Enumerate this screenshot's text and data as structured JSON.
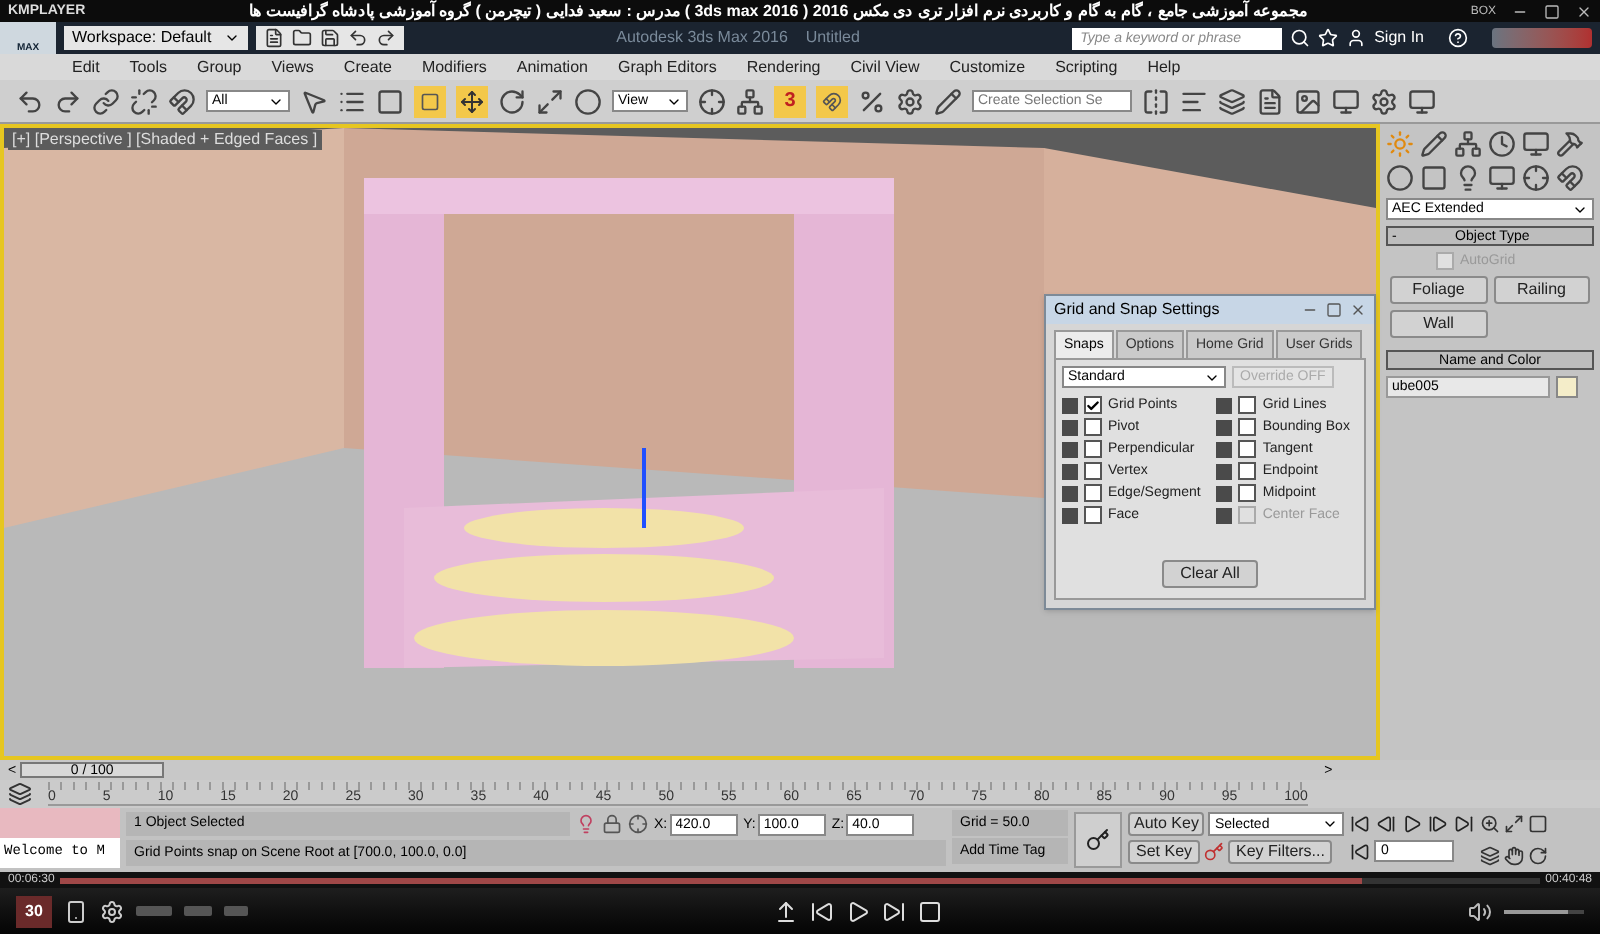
{
  "player": {
    "name": "KMPLAYER",
    "video_title": "مجموعه آموزشی جامع ، گام به گام و کاربردی نرم افزار تری دی مکس 2016 ( 3ds max 2016 )  مدرس : سعید فدایی ( تیچرمن ) گروه آموزشی پادشاه گرافیست ها",
    "box": "BOX"
  },
  "app": {
    "logo_label": "MAX",
    "workspace": "Workspace: Default",
    "title": "Autodesk 3ds Max 2016    Untitled",
    "search": {
      "placeholder": "Type a keyword or phrase"
    },
    "sign_in": "Sign In"
  },
  "menu": [
    "Edit",
    "Tools",
    "Group",
    "Views",
    "Create",
    "Modifiers",
    "Animation",
    "Graph Editors",
    "Rendering",
    "Civil View",
    "Customize",
    "Scripting",
    "Help"
  ],
  "toolbar": {
    "selection_filter": "All",
    "reference_coord": "View",
    "snap_toggle": {
      "label": "3",
      "on": true
    },
    "selection_set": {
      "placeholder": "Create Selection Se"
    }
  },
  "viewport": {
    "label": "[+] [Perspective ] [Shaded + Edged Faces ]",
    "active": true
  },
  "dialog": {
    "title": "Grid and Snap Settings",
    "tabs": [
      {
        "label": "Snaps",
        "selected": true
      },
      {
        "label": "Options",
        "selected": false
      },
      {
        "label": "Home Grid",
        "selected": false
      },
      {
        "label": "User Grids",
        "selected": false
      }
    ],
    "preset": "Standard",
    "override": {
      "label": "Override OFF",
      "disabled": true
    },
    "snaps": [
      {
        "label": "Grid Points",
        "checked": true,
        "disabled": false
      },
      {
        "label": "Pivot",
        "checked": false,
        "disabled": false
      },
      {
        "label": "Perpendicular",
        "checked": false,
        "disabled": false
      },
      {
        "label": "Vertex",
        "checked": false,
        "disabled": false
      },
      {
        "label": "Edge/Segment",
        "checked": false,
        "disabled": false
      },
      {
        "label": "Face",
        "checked": false,
        "disabled": false
      },
      {
        "label": "Grid Lines",
        "checked": false,
        "disabled": false
      },
      {
        "label": "Bounding Box",
        "checked": false,
        "disabled": false
      },
      {
        "label": "Tangent",
        "checked": false,
        "disabled": false
      },
      {
        "label": "Endpoint",
        "checked": false,
        "disabled": false
      },
      {
        "label": "Midpoint",
        "checked": false,
        "disabled": false
      },
      {
        "label": "Center Face",
        "checked": false,
        "disabled": true
      }
    ],
    "clear": "Clear All"
  },
  "command_panel": {
    "category": "AEC Extended",
    "object_type": {
      "toggle": "-",
      "title": "Object Type",
      "autogrid": {
        "label": "AutoGrid",
        "checked": false,
        "disabled": true
      },
      "buttons": [
        "Foliage",
        "Railing",
        "Wall"
      ]
    },
    "name_and_color": {
      "title": "Name and Color",
      "name": "ube005",
      "color": "#f4edc9"
    }
  },
  "time_slider": {
    "prev": "<",
    "label": "0 / 100",
    "next": ">",
    "level": 0
  },
  "ruler": [
    "0",
    "5",
    "10",
    "15",
    "20",
    "25",
    "30",
    "35",
    "40",
    "45",
    "50",
    "55",
    "60",
    "65",
    "70",
    "75",
    "80",
    "85",
    "90",
    "95",
    "100"
  ],
  "status": {
    "listener": "Welcome to M",
    "selection": "1 Object Selected",
    "prompt": "Grid Points snap on Scene Root at [700.0, 100.0, 0.0]",
    "coords": [
      {
        "label": "X:",
        "value": "420.0"
      },
      {
        "label": "Y:",
        "value": "100.0"
      },
      {
        "label": "Z:",
        "value": "40.0"
      }
    ],
    "grid": "Grid = 50.0",
    "time_tag": "Add Time Tag"
  },
  "animation": {
    "auto_key": "Auto Key",
    "key_mode": "Selected",
    "set_key": "Set Key",
    "key_filters": "Key Filters...",
    "frame": "0"
  },
  "playback": {
    "elapsed": "00:06:30",
    "total": "00:40:48",
    "progress": {
      "level": 0.88
    },
    "volume": {
      "level": 0.8
    },
    "fps_badge": "30"
  }
}
